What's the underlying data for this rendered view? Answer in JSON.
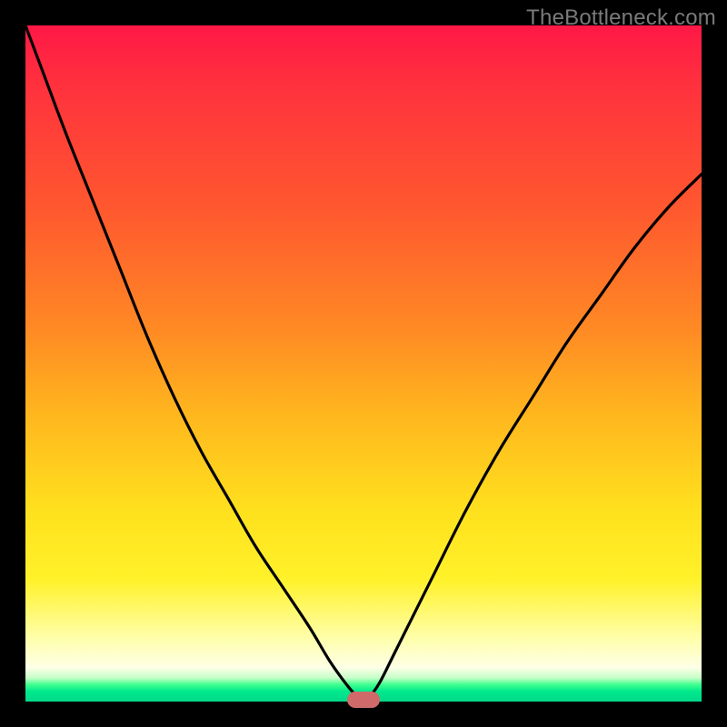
{
  "watermark": "TheBottleneck.com",
  "chart_data": {
    "type": "line",
    "title": "",
    "xlabel": "",
    "ylabel": "",
    "x": [
      0.0,
      0.03,
      0.06,
      0.1,
      0.14,
      0.18,
      0.22,
      0.26,
      0.3,
      0.34,
      0.38,
      0.42,
      0.45,
      0.475,
      0.49,
      0.5,
      0.51,
      0.525,
      0.55,
      0.6,
      0.65,
      0.7,
      0.75,
      0.8,
      0.85,
      0.9,
      0.95,
      1.0
    ],
    "values": [
      1.0,
      0.92,
      0.84,
      0.74,
      0.64,
      0.54,
      0.45,
      0.37,
      0.3,
      0.23,
      0.17,
      0.11,
      0.06,
      0.025,
      0.008,
      0.0,
      0.008,
      0.03,
      0.08,
      0.18,
      0.28,
      0.37,
      0.45,
      0.53,
      0.6,
      0.67,
      0.73,
      0.78
    ],
    "ylim": [
      0,
      1
    ],
    "xlim": [
      0,
      1
    ],
    "marker": {
      "x": 0.5,
      "y": 0.0
    },
    "background_gradient": {
      "direction": "vertical",
      "stops": [
        {
          "pos": 0.0,
          "color": "#ff1846"
        },
        {
          "pos": 0.5,
          "color": "#ffb81e"
        },
        {
          "pos": 0.82,
          "color": "#fff22a"
        },
        {
          "pos": 0.95,
          "color": "#fdffe6"
        },
        {
          "pos": 1.0,
          "color": "#00d98a"
        }
      ]
    }
  },
  "colors": {
    "frame": "#000000",
    "curve": "#000000",
    "marker": "#d06a6a",
    "watermark": "#7a7a7a"
  }
}
